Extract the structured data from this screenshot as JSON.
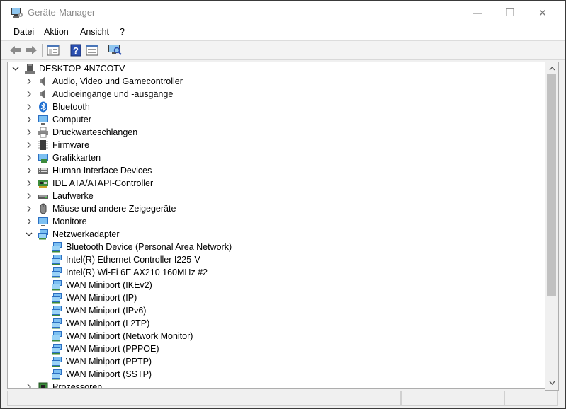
{
  "window": {
    "title": "Geräte-Manager"
  },
  "caption": {
    "minimize": "—",
    "maximize": "☐",
    "close": "✕"
  },
  "menu": [
    "Datei",
    "Aktion",
    "Ansicht",
    "?"
  ],
  "tree": {
    "root": "DESKTOP-4N7COTV",
    "categories": [
      {
        "label": "Audio, Video und Gamecontroller",
        "icon": "speaker-icon"
      },
      {
        "label": "Audioeingänge und -ausgänge",
        "icon": "speaker-icon"
      },
      {
        "label": "Bluetooth",
        "icon": "bluetooth-icon"
      },
      {
        "label": "Computer",
        "icon": "computer-icon"
      },
      {
        "label": "Druckwarteschlangen",
        "icon": "printer-icon"
      },
      {
        "label": "Firmware",
        "icon": "chip-icon"
      },
      {
        "label": "Grafikkarten",
        "icon": "display-adapter-icon"
      },
      {
        "label": "Human Interface Devices",
        "icon": "keyboard-icon"
      },
      {
        "label": "IDE ATA/ATAPI-Controller",
        "icon": "controller-card-icon"
      },
      {
        "label": "Laufwerke",
        "icon": "disk-drive-icon"
      },
      {
        "label": "Mäuse und andere Zeigegeräte",
        "icon": "mouse-icon"
      },
      {
        "label": "Monitore",
        "icon": "monitor-icon"
      },
      {
        "label": "Netzwerkadapter",
        "icon": "network-adapter-icon"
      }
    ],
    "network_adapters": [
      "Bluetooth Device (Personal Area Network)",
      "Intel(R) Ethernet Controller I225-V",
      "Intel(R) Wi-Fi 6E AX210 160MHz #2",
      "WAN Miniport (IKEv2)",
      "WAN Miniport (IP)",
      "WAN Miniport (IPv6)",
      "WAN Miniport (L2TP)",
      "WAN Miniport (Network Monitor)",
      "WAN Miniport (PPPOE)",
      "WAN Miniport (PPTP)",
      "WAN Miniport (SSTP)"
    ],
    "after": [
      {
        "label": "Prozessoren",
        "icon": "processor-icon"
      }
    ]
  },
  "colors": {
    "accent": "#3c8fd6",
    "selection": "#cce8ff"
  }
}
